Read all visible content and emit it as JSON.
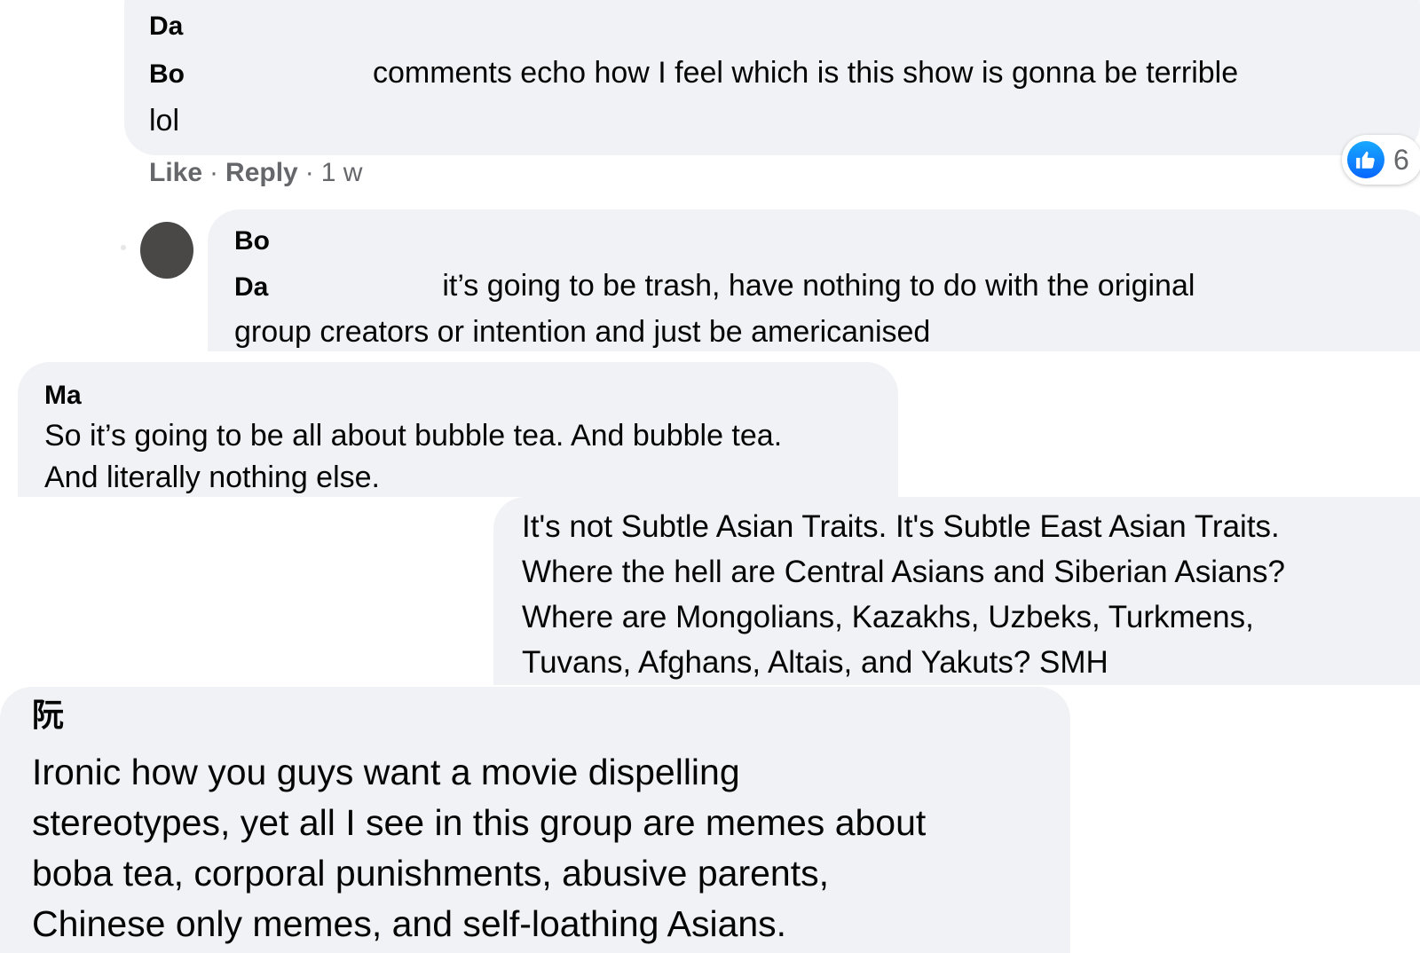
{
  "comments": [
    {
      "author_line1": "Da",
      "author_line2": "Bo",
      "text_after_tag": "comments echo how I feel which is this show is gonna be terrible",
      "text_line2": "lol",
      "actions": {
        "like": "Like",
        "reply": "Reply",
        "time": "1 w"
      },
      "reactions": {
        "icon": "thumbs-up-icon",
        "count": "6"
      }
    },
    {
      "author": "Bo",
      "tag": "Da",
      "text_after_tag": "it’s going to be trash, have nothing to do with the original",
      "text_line2": "group creators or intention and just be americanised"
    },
    {
      "author": "Ma",
      "lines": [
        "So it’s going to be all about bubble tea. And bubble tea.",
        "And literally nothing else."
      ]
    },
    {
      "lines": [
        "It's not Subtle Asian Traits. It's Subtle East Asian Traits.",
        "Where the hell are Central Asians and Siberian Asians?",
        "Where are Mongolians, Kazakhs, Uzbeks, Turkmens,",
        "Tuvans, Afghans, Altais, and Yakuts? SMH"
      ]
    },
    {
      "author": "阮",
      "lines": [
        "Ironic how you guys want a movie dispelling",
        "stereotypes, yet all I see in this group are memes about",
        "boba tea, corporal punishments, abusive parents,",
        "Chinese only memes, and self-loathing Asians."
      ]
    }
  ],
  "colors": {
    "bubble": "#f0f2f5",
    "meta": "#65676b",
    "like": "#0866ff"
  }
}
